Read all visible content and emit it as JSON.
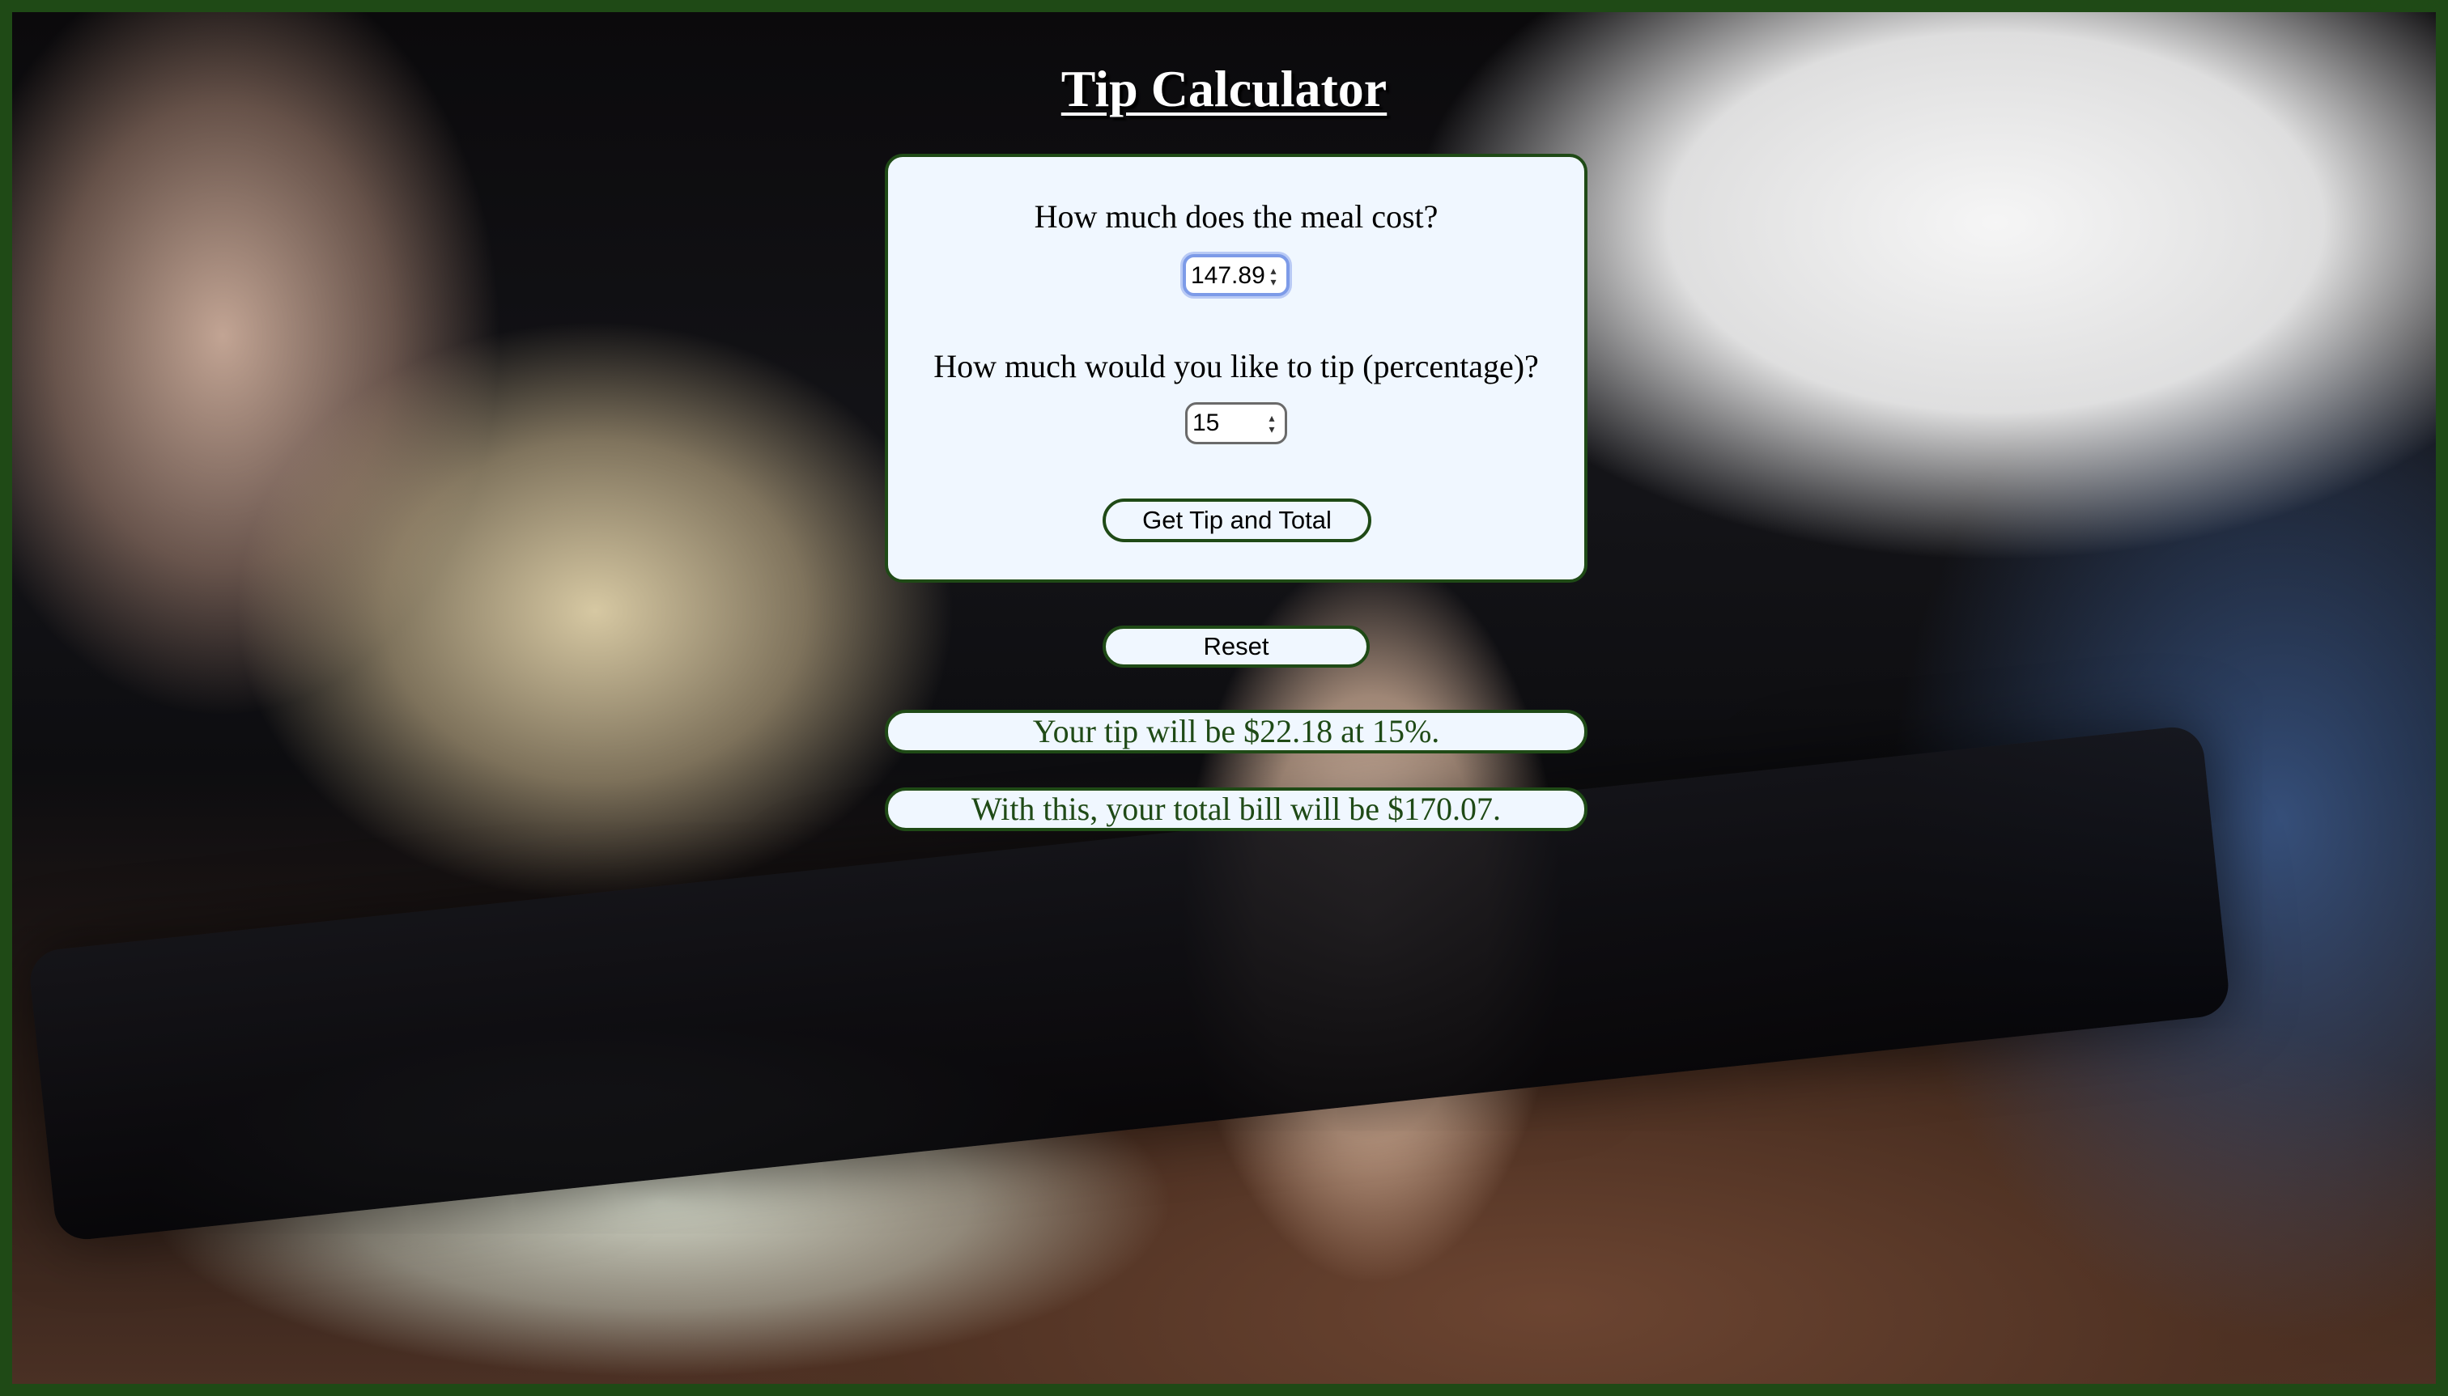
{
  "header": {
    "title": "Tip Calculator"
  },
  "form": {
    "meal_question": "How much does the meal cost?",
    "meal_value": "147.89",
    "tip_question": "How much would you like to tip (percentage)?",
    "tip_value": "15",
    "submit_label": "Get Tip and Total"
  },
  "controls": {
    "reset_label": "Reset"
  },
  "results": {
    "tip_text": "Your tip will be $22.18 at 15%.",
    "total_text": "With this, your total bill will be $170.07."
  },
  "colors": {
    "border_green": "#1f4a16",
    "panel_background": "#f0f7ff",
    "focus_ring": "#7d9be8"
  },
  "icons": {
    "spinner": "spinner-arrows-icon"
  }
}
